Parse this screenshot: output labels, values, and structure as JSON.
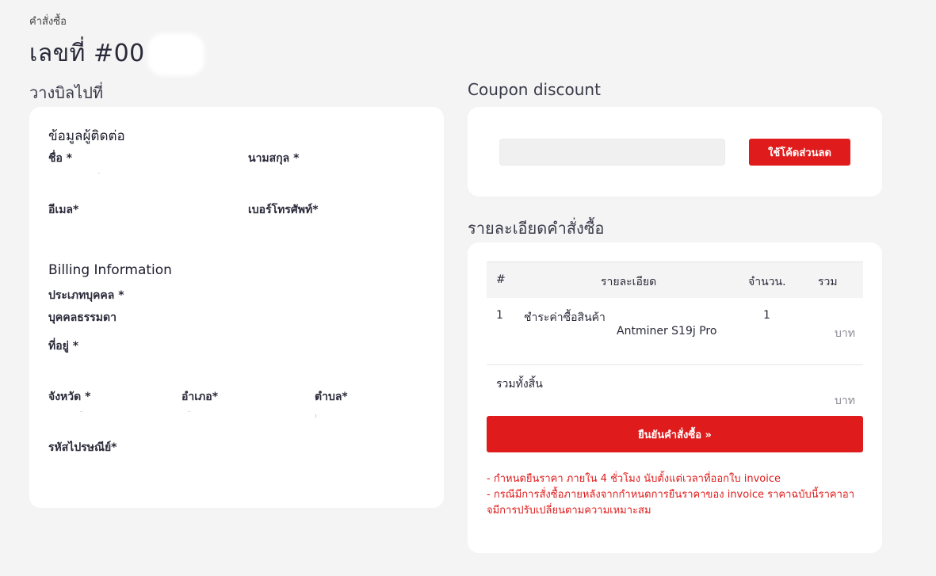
{
  "breadcrumb": "คำสั่งซื้อ",
  "order_title": "เลขที่ #00",
  "billing": {
    "section_title": "วางบิลไปที่",
    "contact_title": "ข้อมูลผู้ติดต่อ",
    "first_name_label": "ชื่อ *",
    "last_name_label": "นามสกุล *",
    "email_label": "อีเมล*",
    "phone_label": "เบอร์โทรศัพท์*",
    "billing_info_title": "Billing Information",
    "person_type_label": "ประเภทบุคคล *",
    "person_type_value": "บุคคลธรรมดา",
    "address_label": "ที่อยู่ *",
    "province_label": "จังหวัด *",
    "district_label": "อำเภอ*",
    "subdistrict_label": "ตำบล*",
    "postcode_label": "รหัสไปรษณีย์*"
  },
  "coupon": {
    "section_title": "Coupon discount",
    "input_value": "",
    "button_label": "ใช้โค้ดส่วนลด"
  },
  "order_detail": {
    "section_title": "รายละเอียดคำสั่งซื้อ",
    "columns": [
      "#",
      "รายละเอียด",
      "จำนวน.",
      "รวม"
    ],
    "rows": [
      {
        "no": "1",
        "desc": "ชำระค่าซื้อสินค้า",
        "product": "Antminer S19j Pro",
        "qty": "1",
        "unit": "บาท"
      }
    ],
    "total_label": "รวมทั้งสิ้น",
    "total_unit": "บาท",
    "confirm_label": "ยืนยันคำสั่งซื้อ »",
    "notes": [
      "- กำหนดยืนราคา ภายใน 4 ชั่วโมง นับตั้งแต่เวลาที่ออกใบ invoice",
      "- กรณีมีการสั่งซื้อภายหลังจากกำหนดการยืนราคาของ invoice ราคาฉบับนี้ราคาอา จมีการปรับเปลี่ยนตามความเหมาะสม"
    ]
  },
  "colors": {
    "accent": "#e01b1b",
    "background": "#f4f4f4",
    "card": "#ffffff"
  }
}
